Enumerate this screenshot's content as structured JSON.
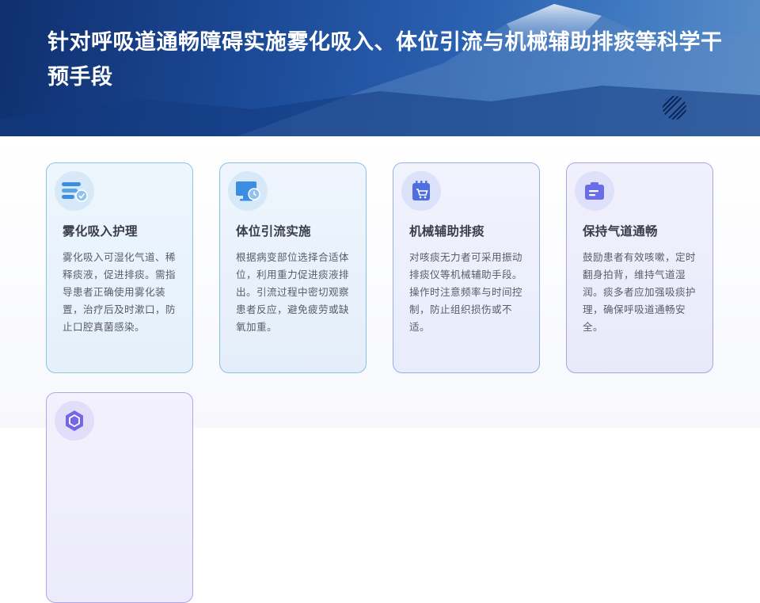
{
  "header": {
    "title": "针对呼吸道通畅障碍实施雾化吸入、体位引流与机械辅助排痰等科学干预手段"
  },
  "cards": [
    {
      "icon": "nebulizer-icon",
      "title": "雾化吸入护理",
      "body": "雾化吸入可湿化气道、稀释痰液，促进排痰。需指导患者正确使用雾化装置，治疗后及时漱口，防止口腔真菌感染。"
    },
    {
      "icon": "monitor-icon",
      "title": "体位引流实施",
      "body": "根据病变部位选择合适体位，利用重力促进痰液排出。引流过程中密切观察患者反应，避免疲劳或缺氧加重。"
    },
    {
      "icon": "device-cart-icon",
      "title": "机械辅助排痰",
      "body": "对咳痰无力者可采用振动排痰仪等机械辅助手段。操作时注意频率与时间控制，防止组织损伤或不适。"
    },
    {
      "icon": "clipboard-icon",
      "title": "保持气道通畅",
      "body": "鼓励患者有效咳嗽，定时翻身拍背，维持气道湿润。痰多者应加强吸痰护理，确保呼吸道通畅安全。"
    },
    {
      "icon": "hexagon-icon",
      "title": "",
      "body": ""
    }
  ],
  "colors": {
    "banner": "#1c4b98",
    "icon_blue": "#3a8de0",
    "icon_indigo": "#4f6fe0",
    "icon_violet": "#6a6ee6"
  }
}
